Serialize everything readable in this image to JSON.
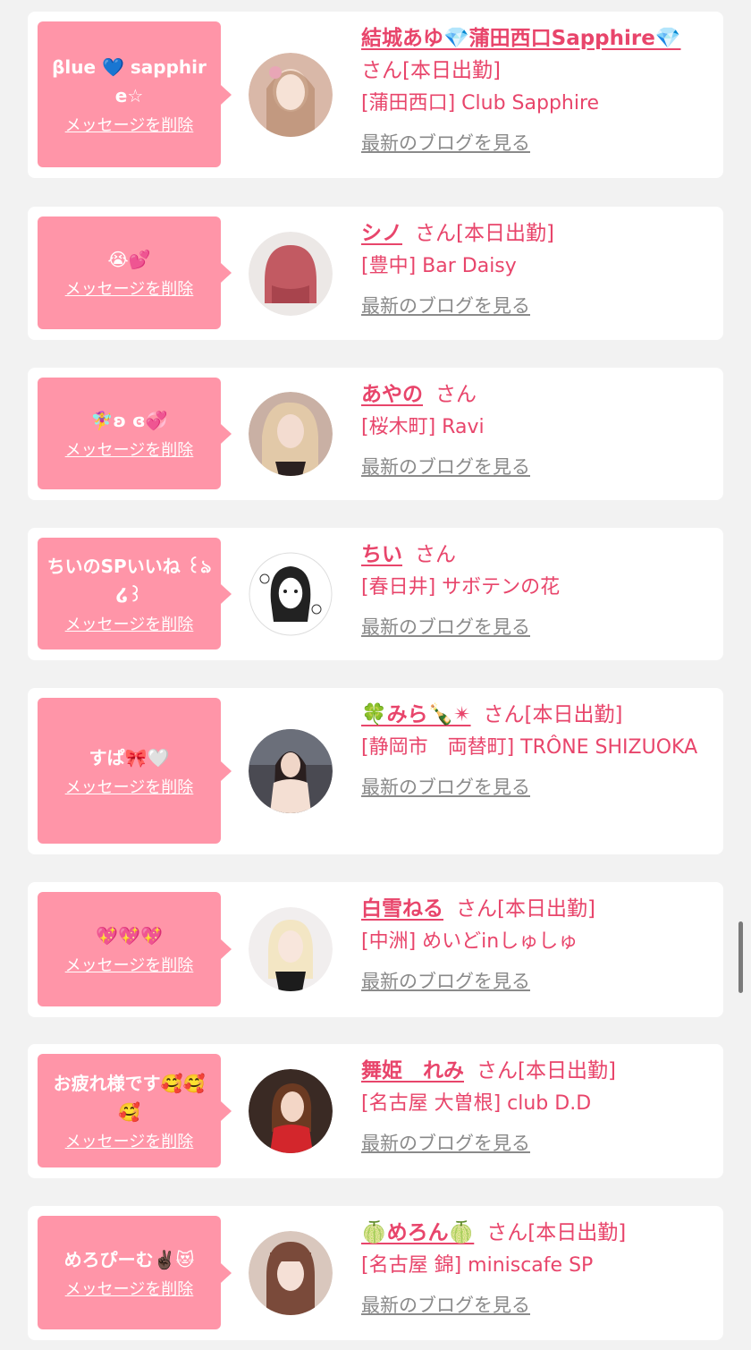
{
  "cards": [
    {
      "message": "βlue 💙 sapphire☆",
      "delete_label": "メッセージを削除",
      "name": "結城あゆ💎蒲田西口Sapphire💎",
      "suffix": "さん[本日出勤]",
      "shop": "[蒲田西口] Club Sapphire",
      "blog_label": "最新のブログを見る"
    },
    {
      "message": "😭💕",
      "delete_label": "メッセージを削除",
      "name": "シノ",
      "suffix": "さん[本日出勤]",
      "shop": "[豊中] Bar Daisy",
      "blog_label": "最新のブログを見る"
    },
    {
      "message": "🧚‍♀️ʚ ɞ💞",
      "delete_label": "メッセージを削除",
      "name": "あやの",
      "suffix": "さん",
      "shop": "[桜木町] Ravi",
      "blog_label": "最新のブログを見る"
    },
    {
      "message": "ちいのSPいいね ꒰ঌ໒꒱",
      "delete_label": "メッセージを削除",
      "name": "ちい",
      "suffix": "さん",
      "shop": "[春日井] サボテンの花",
      "blog_label": "最新のブログを見る"
    },
    {
      "message": "すぱ🎀🤍",
      "delete_label": "メッセージを削除",
      "name": "🍀みら🍾✴︎",
      "suffix": "さん[本日出勤]",
      "shop": "[静岡市　両替町] TRÔNE SHIZUOKA",
      "blog_label": "最新のブログを見る"
    },
    {
      "message": "💖💖💖",
      "delete_label": "メッセージを削除",
      "name": "白雪ねる",
      "suffix": "さん[本日出勤]",
      "shop": "[中洲] めいどinしゅしゅ",
      "blog_label": "最新のブログを見る"
    },
    {
      "message": "お疲れ様です🥰🥰🥰",
      "delete_label": "メッセージを削除",
      "name": "舞姫　れみ",
      "suffix": "さん[本日出勤]",
      "shop": "[名古屋 大曽根] club D.D",
      "blog_label": "最新のブログを見る"
    },
    {
      "message": "めろぴーむ✌🏿😻",
      "delete_label": "メッセージを削除",
      "name": "🍈めろん🍈",
      "suffix": "さん[本日出勤]",
      "shop": "[名古屋 錦] miniscafe SP",
      "blog_label": "最新のブログを見る"
    }
  ],
  "colors": {
    "page_bg": "#f2f2f2",
    "bubble_bg": "#ff95a8",
    "accent_text": "#e8456b",
    "blog_link": "#8a8a8a"
  }
}
